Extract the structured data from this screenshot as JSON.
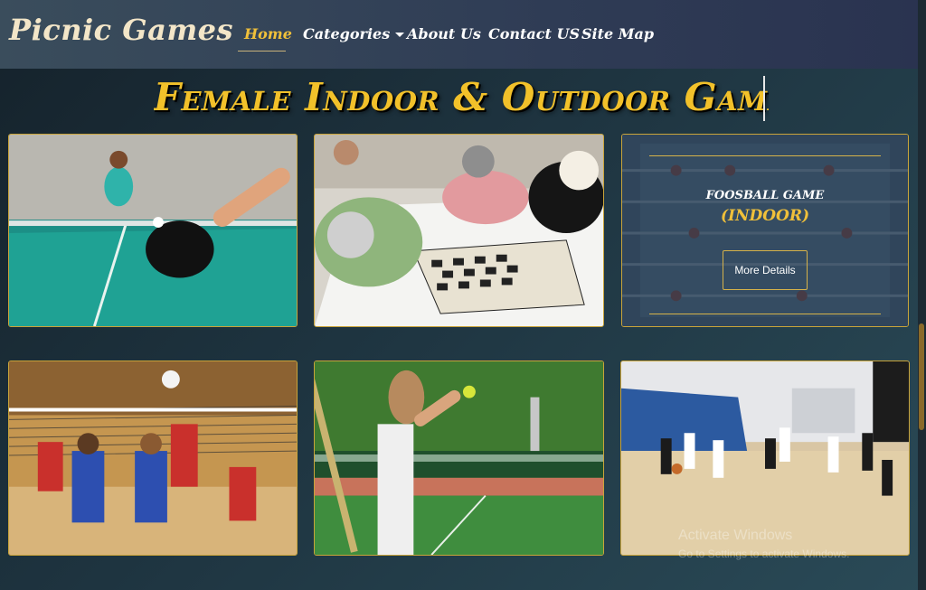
{
  "navbar": {
    "brand": "Picnic Games",
    "items": [
      {
        "label": "Home",
        "active": true
      },
      {
        "label": "Categories",
        "has_dropdown": true
      },
      {
        "label": "About Us"
      },
      {
        "label": "Contact US"
      },
      {
        "label": "Site Map"
      }
    ]
  },
  "main": {
    "title": "Female Indoor & Outdoor Games",
    "cards": [
      {
        "name": "table-tennis",
        "icon": "table-tennis-photo"
      },
      {
        "name": "chess",
        "icon": "chess-photo"
      },
      {
        "name": "foosball",
        "icon": "foosball-photo",
        "overlay_title": "FOOSBALL GAME",
        "overlay_sub": "(INDOOR)",
        "button_label": "More Details"
      },
      {
        "name": "volleyball",
        "icon": "volleyball-photo"
      },
      {
        "name": "tennis",
        "icon": "tennis-photo"
      },
      {
        "name": "basketball",
        "icon": "basketball-photo"
      }
    ]
  },
  "watermark": {
    "line1": "Activate Windows",
    "line2": "Go to Settings to activate Windows."
  },
  "colors": {
    "accent": "#f0c03a",
    "card_border": "#c9a43a"
  }
}
